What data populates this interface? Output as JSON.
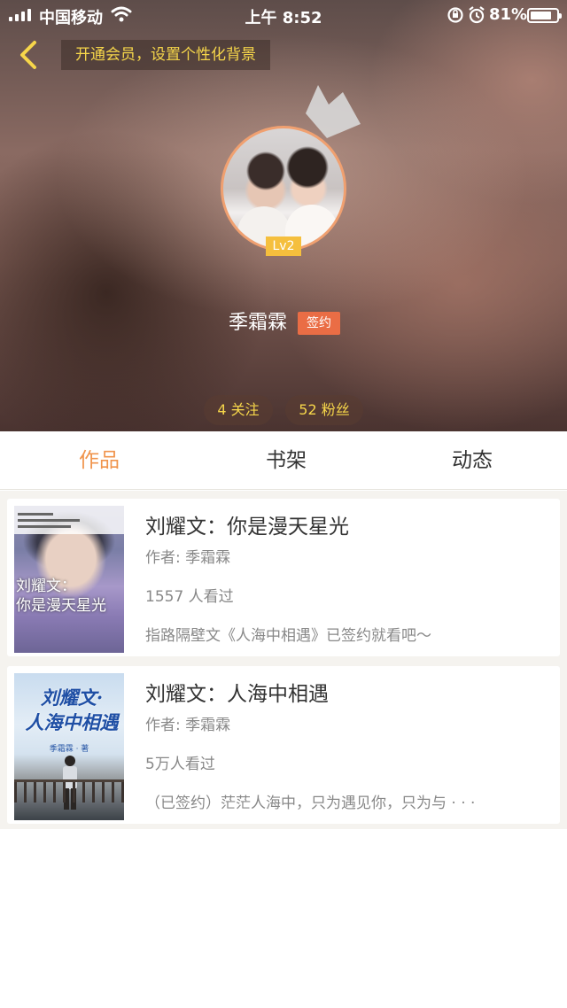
{
  "status_bar": {
    "carrier": "中国移动",
    "time": "上午 8:52",
    "battery_percent": "81%",
    "battery_level": 0.81,
    "icons": [
      "signal-icon",
      "wifi-icon",
      "rotation-lock-icon",
      "alarm-icon",
      "battery-icon"
    ]
  },
  "header": {
    "back_icon": "chevron-left-icon",
    "vip_banner": "开通会员，设置个性化背景",
    "level": "Lv2",
    "username": "季霜霖",
    "signed_badge": "签约",
    "follow": "4 关注",
    "fans": "52 粉丝"
  },
  "colors": {
    "accent_orange": "#f0944c",
    "badge_orange": "#ea6d45",
    "level_yellow": "#f5bf3d",
    "banner_yellow": "#f6d64a"
  },
  "tabs": [
    {
      "label": "作品",
      "active": true
    },
    {
      "label": "书架",
      "active": false
    },
    {
      "label": "动态",
      "active": false
    }
  ],
  "books": [
    {
      "title": "刘耀文：你是漫天星光",
      "author": "作者: 季霜霖",
      "views": "1557 人看过",
      "description": "指路隔壁文《人海中相遇》已签约就看吧～",
      "cover_text": "刘耀文：\n你是漫天星光"
    },
    {
      "title": "刘耀文：人海中相遇",
      "author": "作者: 季霜霖",
      "views": "5万人看过",
      "description": "（已签约）茫茫人海中，只为遇见你，只为与 · · ·",
      "cover_text": "刘耀文·\n人海中相遇"
    }
  ]
}
